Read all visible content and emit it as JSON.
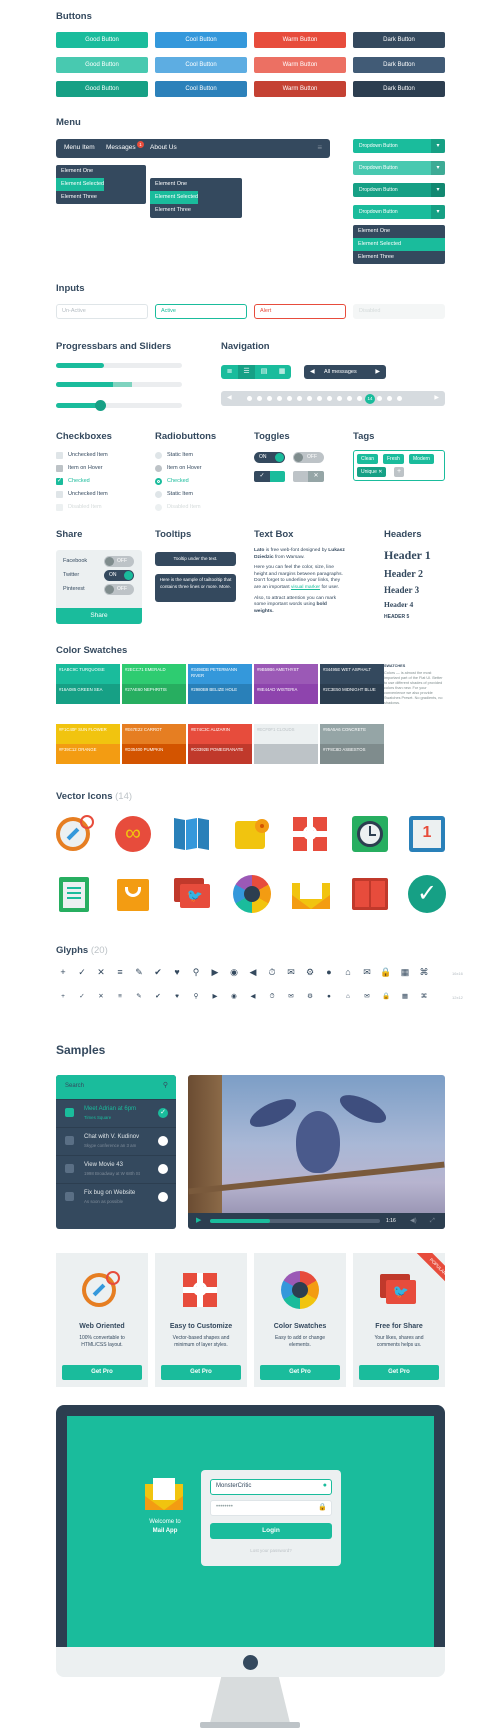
{
  "colors": {
    "turquoise": "#1abc9c",
    "emerald": "#2ecc71",
    "peter_river": "#3498db",
    "amethyst": "#9b59b6",
    "wet_asphalt": "#34495e",
    "alizarin": "#e74c3c",
    "concrete": "#95a5a6"
  },
  "buttons": {
    "title": "Buttons",
    "good": "Good Button",
    "cool": "Cool Button",
    "warm": "Warm Button",
    "dark": "Dark Button"
  },
  "menu": {
    "title": "Menu",
    "item1": "Menu Item",
    "item2": "Messages",
    "badge": "1",
    "item3": "About Us",
    "sub_a": [
      "Element One",
      "Element Selected",
      "Element Three"
    ],
    "sub_b": [
      "Element One",
      "Element Selected",
      "Element Three"
    ],
    "dropdown": "Dropdown Button",
    "dd_list": [
      "Element One",
      "Element Selected",
      "Element Three"
    ]
  },
  "inputs": {
    "title": "Inputs",
    "inactive": "Un-Active",
    "active": "Active",
    "alert": "Alert",
    "disabled": "Disabled"
  },
  "progress": {
    "title": "Progressbars and Sliders",
    "bar1": 0.38,
    "bar2_a": 0.45,
    "bar2_b": 0.6,
    "slider": 0.35
  },
  "navigation": {
    "title": "Navigation",
    "all_messages": "All messages",
    "current_page": "14"
  },
  "checkboxes": {
    "title": "Checkboxes",
    "items": [
      "Unchecked Item",
      "Item on Hover",
      "Checked",
      "Unchecked Item",
      "Disabled Item"
    ]
  },
  "radios": {
    "title": "Radiobuttons",
    "items": [
      "Static Item",
      "Item on Hover",
      "Checked",
      "Static Item",
      "Disabled Item"
    ]
  },
  "toggles": {
    "title": "Toggles",
    "on": "ON",
    "off": "OFF"
  },
  "tags": {
    "title": "Tags",
    "items": [
      "Clean",
      "Fresh",
      "Modern",
      "Unique"
    ]
  },
  "share": {
    "title": "Share",
    "items": [
      "Facebook",
      "Twitter",
      "Pinterest"
    ],
    "on": "ON",
    "off": "OFF",
    "button": "Share"
  },
  "tooltips": {
    "title": "Tooltips",
    "t1": "Tooltip under the text.",
    "t2": "Here is the sample of tailtooltip that contains three lines or more. More."
  },
  "textbox": {
    "title": "Text Box",
    "p1a": "Lato",
    "p1b": "is free web-font designed by",
    "p1c": "Lukasz Dziedzic",
    "p1d": "from Warsaw.",
    "p2": "Here you can feel the color, size, line height and margins between paragraphs. Don't forget to underline your links, they are an important",
    "p2link": "visual marker",
    "p2end": "for user.",
    "p3": "Also, to attract attention you can mark some important words using",
    "p3b": "bold weights."
  },
  "headers": {
    "title": "Headers",
    "h1": "Header 1",
    "h2": "Header 2",
    "h3": "Header 3",
    "h4": "Header 4",
    "h5": "HEADER 5"
  },
  "swatches": {
    "title": "Color Swatches",
    "grid": [
      [
        {
          "hex": "#1ABC9C",
          "name": "TURQUOISE"
        },
        {
          "hex": "#2ECC71",
          "name": "EMERALD"
        },
        {
          "hex": "#3498DB",
          "name": "PETERMANN RIVER"
        },
        {
          "hex": "#9B59B6",
          "name": "AMETHYST"
        },
        {
          "hex": "#34495E",
          "name": "WET ASPHALT"
        }
      ],
      [
        {
          "hex": "#16A085",
          "name": "GREEN SEA"
        },
        {
          "hex": "#27AE60",
          "name": "NEPHRITIS"
        },
        {
          "hex": "#2980B9",
          "name": "BELIZE HOLE"
        },
        {
          "hex": "#8E44AD",
          "name": "WISTERIA"
        },
        {
          "hex": "#2C3E50",
          "name": "MIDNIGHT BLUE"
        }
      ],
      [
        {
          "hex": "#F1C40F",
          "name": "SUN FLOWER"
        },
        {
          "hex": "#E67E22",
          "name": "CARROT"
        },
        {
          "hex": "#E74C3C",
          "name": "ALIZARIN"
        },
        {
          "hex": "#ECF0F1",
          "name": "CLOUDS"
        },
        {
          "hex": "#95A5A6",
          "name": "CONCRETE"
        }
      ],
      [
        {
          "hex": "#F39C12",
          "name": "ORANGE"
        },
        {
          "hex": "#D35400",
          "name": "PUMPKIN"
        },
        {
          "hex": "#C0392B",
          "name": "POMEGRANATE"
        },
        {
          "hex": "#BDC3C7",
          "name": "SILVER"
        },
        {
          "hex": "#7F8C8D",
          "name": "ASBESTOS"
        }
      ]
    ],
    "note_title": "SWATCHES",
    "note": "Colors — is almost the most important part of the Flat UI. Better to use different shades of provided colors than new. For your convenience we also provide Swatches Preset. No gradients, no shadows."
  },
  "vector_icons": {
    "title": "Vector Icons",
    "count": "(14)",
    "icons": [
      "compass-icon",
      "infinity-icon",
      "map-icon",
      "toilet-paper-icon",
      "gift-icon",
      "clock-icon",
      "calendar-icon",
      "clipboard-icon",
      "shopping-bag-icon",
      "twitter-chat-icon",
      "color-wheel-icon",
      "mail-icon",
      "book-icon",
      "check-badge-icon"
    ],
    "calendar_day": "1"
  },
  "glyphs": {
    "title": "Glyphs",
    "count": "(20)",
    "row1": [
      "+",
      "✓",
      "✕",
      "≡",
      "✎",
      "✔",
      "♥",
      "⚲",
      "▶",
      "◉",
      "◀",
      "⏱",
      "✉",
      "⚙",
      "●",
      "⌂",
      "✉",
      "🔒",
      "▦",
      "⌘"
    ],
    "label1": "16x16",
    "label2": "12x12"
  },
  "samples": {
    "title": "Samples",
    "search_placeholder": "Search",
    "todos": [
      {
        "a": "Meet Adrian at 6pm",
        "b": "Times Square"
      },
      {
        "a": "Chat with V. Kudinov",
        "b": "Skype conference an 3 am"
      },
      {
        "a": "View Movie 43",
        "b": "1998 Broadway at W 68th St"
      },
      {
        "a": "Fix bug on Website",
        "b": "As soon as possible"
      }
    ],
    "video_time": "1:16",
    "video_progress": 0.35
  },
  "cards": [
    {
      "title": "Web Oriented",
      "desc": "100% convertable to HTML/CSS layout.",
      "btn": "Get Pro"
    },
    {
      "title": "Easy to Customize",
      "desc": "Vector-based shapes and minimum of layer styles.",
      "btn": "Get Pro"
    },
    {
      "title": "Color Swatches",
      "desc": "Easy to add or change elements.",
      "btn": "Get Pro"
    },
    {
      "title": "Free for Share",
      "desc": "Your likes, shares and comments helps us.",
      "btn": "Get Pro"
    }
  ],
  "ribbon": "POPULAR",
  "login": {
    "username": "MonsterCritic",
    "password": "••••••••",
    "button": "Login",
    "lost": "Lost your password?",
    "welcome": "Welcome to",
    "app": "Mail App"
  }
}
